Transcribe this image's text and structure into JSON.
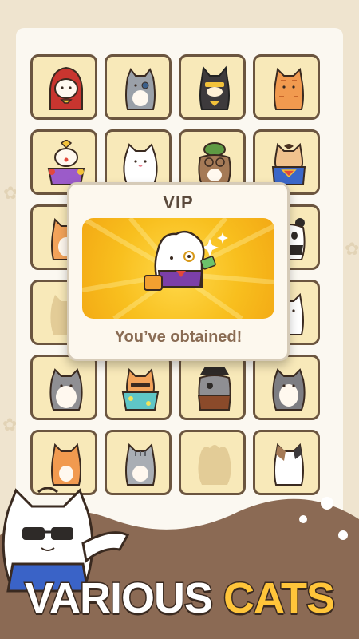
{
  "vip_popup": {
    "title": "VIP",
    "message": "You’ve obtained!"
  },
  "tagline": {
    "word1": "VARIOUS",
    "word2": "CATS"
  },
  "colors": {
    "background": "#efe4cf",
    "board": "#fbf8f1",
    "cell": "#f8e9b9",
    "cell_border": "#6b553f",
    "banner": "#f8bf1e",
    "tag_highlight": "#ffc53a",
    "hill": "#8b6a54"
  },
  "cat_grid": {
    "rows": [
      [
        "red-hood-cat",
        "grey-eyepatch-cat",
        "batman-cat",
        "orange-tabby-cat"
      ],
      [
        "clown-cat",
        "white-fluffy-cat",
        "turtle-hat-cat",
        "superhero-cat"
      ],
      [
        "orange-cat",
        "hidden",
        "hidden",
        "panda-cat"
      ],
      [
        "locked-silhouette",
        "hidden",
        "hidden",
        "white-cat"
      ],
      [
        "grey-white-cat",
        "hawaiian-cat",
        "pirate-cat",
        "grey-long-cat"
      ],
      [
        "orange-white-cat",
        "tabby-grey-cat",
        "locked-silhouette",
        "calico-cat"
      ]
    ]
  }
}
